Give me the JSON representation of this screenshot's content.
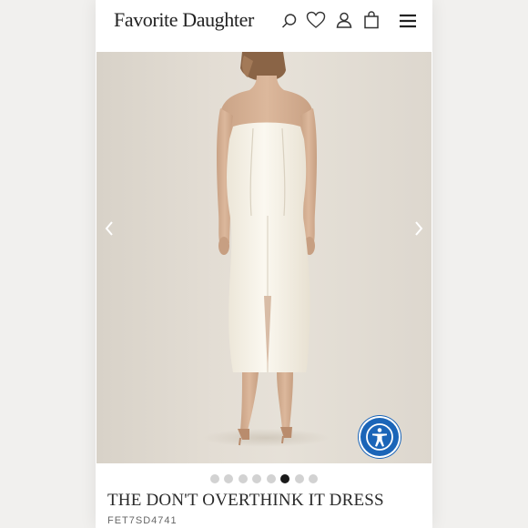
{
  "header": {
    "logo": "Favorite Daughter",
    "icons": [
      "search-icon",
      "heart-icon",
      "user-icon",
      "bag-icon",
      "menu-icon"
    ]
  },
  "gallery": {
    "image": "model-back-view-strapless-ivory-dress",
    "total_slides": 8,
    "active_slide": 6,
    "prev_icon": "chevron-left-icon",
    "next_icon": "chevron-right-icon"
  },
  "accessibility": {
    "icon": "accessibility-icon",
    "color": "#1b65b8"
  },
  "product": {
    "title": "THE DON'T OVERTHINK IT DRESS",
    "sku": "FET7SD4741"
  },
  "colors": {
    "dress": "#f4efe3",
    "background": "#e3ddd4",
    "active_dot": "#1a1a1a",
    "inactive_dot": "#d2d2d2"
  }
}
